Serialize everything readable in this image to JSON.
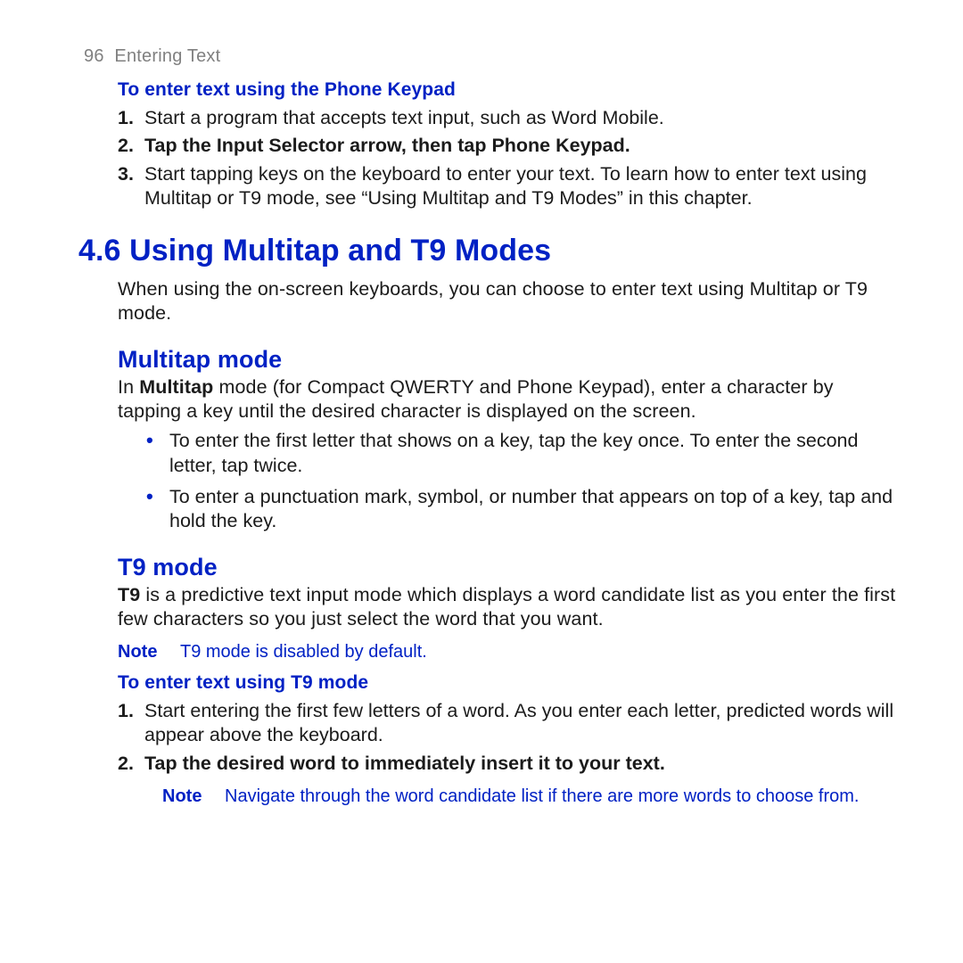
{
  "header": {
    "pagenum": "96",
    "chapter": "Entering Text"
  },
  "sec1": {
    "heading": "To enter text using the Phone Keypad",
    "steps": [
      {
        "n": "1.",
        "html": "Start a program that accepts text input, such as Word Mobile."
      },
      {
        "n": "2.",
        "html": "Tap the <b>Input Selector</b> arrow, then tap <b>Phone Keypad</b>.",
        "boldAll": true
      },
      {
        "n": "3.",
        "html": "Start tapping keys on the keyboard to enter your text. To learn how to enter text using Multitap or T9 mode, see “Using Multitap and T9 Modes” in this chapter."
      }
    ]
  },
  "sec2": {
    "heading": "4.6  Using Multitap and T9 Modes",
    "intro": "When using the on-screen keyboards, you can choose to enter text using Multitap or T9 mode."
  },
  "multitap": {
    "heading": "Multitap mode",
    "introHtml": "In <b>Multitap</b> mode (for Compact QWERTY and Phone Keypad), enter a character by tapping a key until the desired character is displayed on the screen.",
    "bullets": [
      "To enter the first letter that shows on a key, tap the key once. To enter the second letter, tap twice.",
      "To enter a punctuation mark, symbol, or number that appears on top of a key, tap and hold the key."
    ]
  },
  "t9": {
    "heading": "T9 mode",
    "introHtml": "<b>T9</b> is a predictive text input mode which displays a word candidate list as you enter the first few characters so you just select the word that you want.",
    "note1": {
      "label": "Note",
      "text": "T9 mode is disabled by default."
    },
    "subheading": "To enter text using T9 mode",
    "steps": [
      {
        "n": "1.",
        "html": "Start entering the first few letters of a word. As you enter each letter, predicted words will appear above the keyboard."
      },
      {
        "n": "2.",
        "html": "Tap the desired word to immediately insert it to your text.",
        "boldAll": true
      }
    ],
    "note2": {
      "label": "Note",
      "text": "Navigate through the word candidate list if there are more words to choose from."
    }
  }
}
